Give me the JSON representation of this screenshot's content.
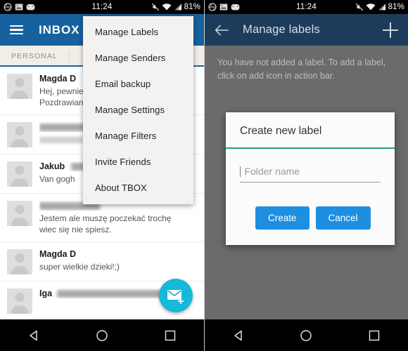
{
  "statusbar": {
    "time": "11:24",
    "battery": "81%",
    "left_icons": [
      "sync-icon",
      "screenshot-icon",
      "app-icon"
    ],
    "right_icons": [
      "mute-icon",
      "wifi-icon",
      "signal-icon"
    ]
  },
  "left_screen": {
    "toolbar": {
      "title": "INBOX",
      "menu_icon": "hamburger-icon"
    },
    "tabs": [
      {
        "label": "PERSONAL",
        "selected": true
      }
    ],
    "messages": [
      {
        "sender": "Magda D",
        "redacted_sender": false,
        "lines": [
          "Hej, pewnie +",
          "Pozdrawiam."
        ],
        "redacted_lines": [
          false,
          false
        ]
      },
      {
        "sender": "",
        "redacted_sender": true,
        "lines": [
          "",
          ""
        ],
        "redacted_lines": [
          true,
          true
        ]
      },
      {
        "sender": "Jakub",
        "redacted_sender": true,
        "lines": [
          "Van gogh"
        ],
        "redacted_lines": [
          false
        ]
      },
      {
        "sender": "",
        "redacted_sender": true,
        "lines": [
          "Jestem ale muszę poczekać trochę",
          "wiec się nie spiesz."
        ],
        "redacted_lines": [
          false,
          false
        ]
      },
      {
        "sender": "Magda D",
        "redacted_sender": false,
        "lines": [
          "super wielkie dzieki!;)"
        ],
        "redacted_lines": [
          false
        ]
      },
      {
        "sender": "Iga",
        "redacted_sender": true,
        "lines": [],
        "redacted_lines": []
      }
    ],
    "fab": {
      "icon": "compose-mail-icon",
      "color": "#17b8d8"
    },
    "menu": {
      "items": [
        "Manage Labels",
        "Manage Senders",
        "Email backup",
        "Manage Settings",
        "Manage Filters",
        "Invite Friends",
        "About TBOX"
      ]
    }
  },
  "right_screen": {
    "toolbar": {
      "title": "Manage labels",
      "back_icon": "back-arrow-icon",
      "add_icon": "plus-icon"
    },
    "empty_state": "You have not added a label. To add a label, click on add icon in action bar.",
    "dialog": {
      "title": "Create new label",
      "input_placeholder": "Folder name",
      "input_value": "",
      "create_label": "Create",
      "cancel_label": "Cancel",
      "accent_color": "#1ea07d",
      "button_color": "#1e8fe0"
    }
  },
  "navbar": {
    "back": "nav-back-icon",
    "home": "nav-home-icon",
    "recents": "nav-recents-icon"
  }
}
